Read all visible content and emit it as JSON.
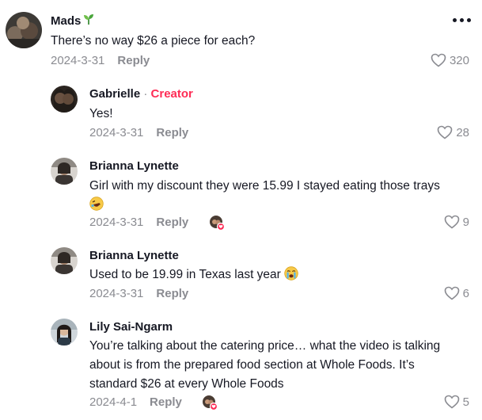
{
  "comments": [
    {
      "author": "Mads",
      "text": "There’s no way $26 a piece for each?",
      "date": "2024-3-31",
      "reply": "Reply",
      "likes": "320"
    },
    {
      "author": "Gabrielle",
      "badge_sep": "·",
      "badge": "Creator",
      "text": "Yes!",
      "date": "2024-3-31",
      "reply": "Reply",
      "likes": "28"
    },
    {
      "author": "Brianna Lynette",
      "text_line1": "Girl with my discount they were 15.99 I stayed eating those trays",
      "emoji": "rolling-on-floor-laughing",
      "date": "2024-3-31",
      "reply": "Reply",
      "likes": "9"
    },
    {
      "author": "Brianna Lynette",
      "text": "Used to be 19.99 in Texas last year",
      "emoji": "loudly-crying-face",
      "date": "2024-3-31",
      "reply": "Reply",
      "likes": "6"
    },
    {
      "author": "Lily Sai-Ngarm",
      "text_lines": [
        "You’re talking about the catering price… what the video is talking",
        "about is from the prepared food section at Whole Foods. It’s",
        "standard $26 at every Whole Foods"
      ],
      "date": "2024-4-1",
      "reply": "Reply",
      "likes": "5"
    }
  ],
  "icons": {
    "like": "heart-outline-icon",
    "more": "more-dots-icon",
    "creator_liked": "creator-liked-avatar-icon",
    "sprout": "sprout-icon"
  },
  "colors": {
    "creator_badge": "#fe2c55",
    "meta_gray": "#8a8b91",
    "text": "#161823"
  }
}
